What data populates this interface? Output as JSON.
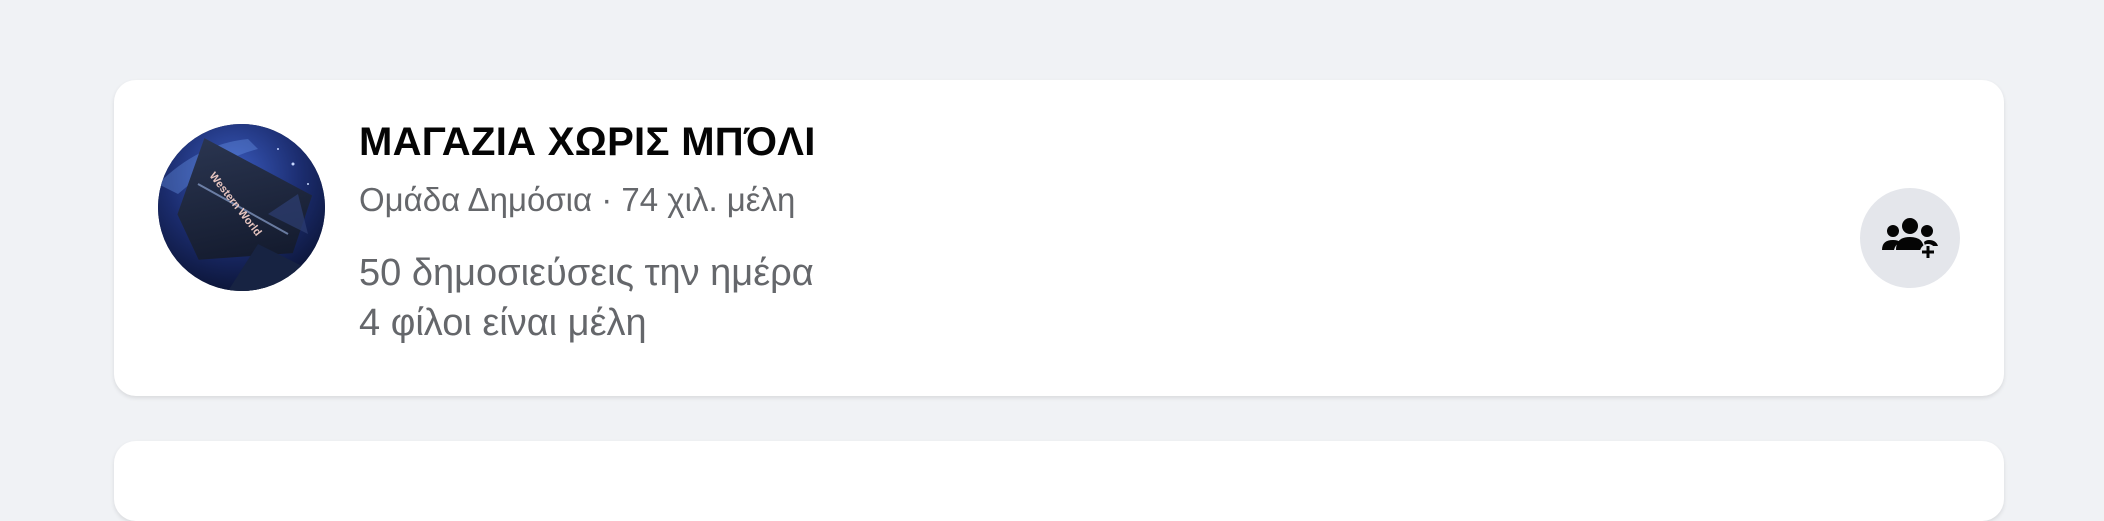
{
  "group": {
    "name": "ΜΑΓΑΖΙΑ ΧΩΡΙΣ ΜΠΌΛΙ",
    "meta": "Ομάδα Δημόσια · 74 χιλ. μέλη",
    "posts_per_day": "50 δημοσιεύσεις την ημέρα",
    "friends_members": "4 φίλοι είναι μέλη",
    "avatar_text": "Western World"
  },
  "actions": {
    "join_icon": "join-group-icon"
  },
  "colors": {
    "background": "#f0f2f5",
    "card": "#ffffff",
    "title": "#050505",
    "secondary_text": "#65676b",
    "button_bg": "#e4e6eb",
    "icon": "#050505"
  }
}
